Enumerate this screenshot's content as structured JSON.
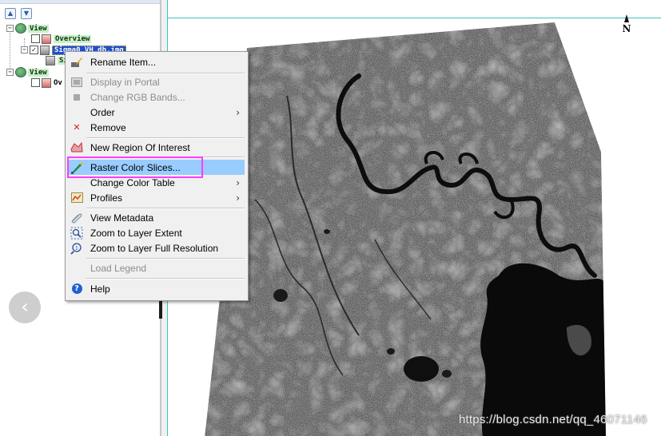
{
  "tree": {
    "items": [
      {
        "label": "View"
      },
      {
        "label": "Overview"
      },
      {
        "label": "Sigma0_VH_db.img"
      },
      {
        "label": "Si"
      },
      {
        "label": "View"
      },
      {
        "label": "Ov"
      }
    ]
  },
  "context_menu": {
    "items": [
      {
        "label": "Rename Item...",
        "icon": "rename-icon",
        "enabled": true
      },
      {
        "label": "Display in Portal",
        "icon": "portal-icon",
        "enabled": false
      },
      {
        "label": "Change RGB Bands...",
        "icon": "rgb-bands-icon",
        "enabled": false
      },
      {
        "label": "Order",
        "icon": "",
        "enabled": true,
        "submenu": true
      },
      {
        "label": "Remove",
        "icon": "remove-icon",
        "enabled": true
      },
      {
        "label": "New Region Of Interest",
        "icon": "roi-icon",
        "enabled": true
      },
      {
        "label": "Raster Color Slices...",
        "icon": "color-slices-icon",
        "enabled": true,
        "highlighted": true
      },
      {
        "label": "Change Color Table",
        "icon": "",
        "enabled": true,
        "submenu": true
      },
      {
        "label": "Profiles",
        "icon": "profiles-icon",
        "enabled": true,
        "submenu": true
      },
      {
        "label": "View Metadata",
        "icon": "metadata-icon",
        "enabled": true
      },
      {
        "label": "Zoom to Layer Extent",
        "icon": "zoom-extent-icon",
        "enabled": true
      },
      {
        "label": "Zoom to Layer Full Resolution",
        "icon": "zoom-full-res-icon",
        "enabled": true
      },
      {
        "label": "Load Legend",
        "icon": "",
        "enabled": false
      },
      {
        "label": "Help",
        "icon": "help-icon",
        "enabled": true
      }
    ],
    "submenu_arrow": "›"
  },
  "map": {
    "north_label": "N"
  },
  "watermark": "https://blog.csdn.net/qq_46071146",
  "colors": {
    "highlight": "#99ccff",
    "annotation_box": "#ff3cff",
    "map_frame": "#39c1c1"
  }
}
